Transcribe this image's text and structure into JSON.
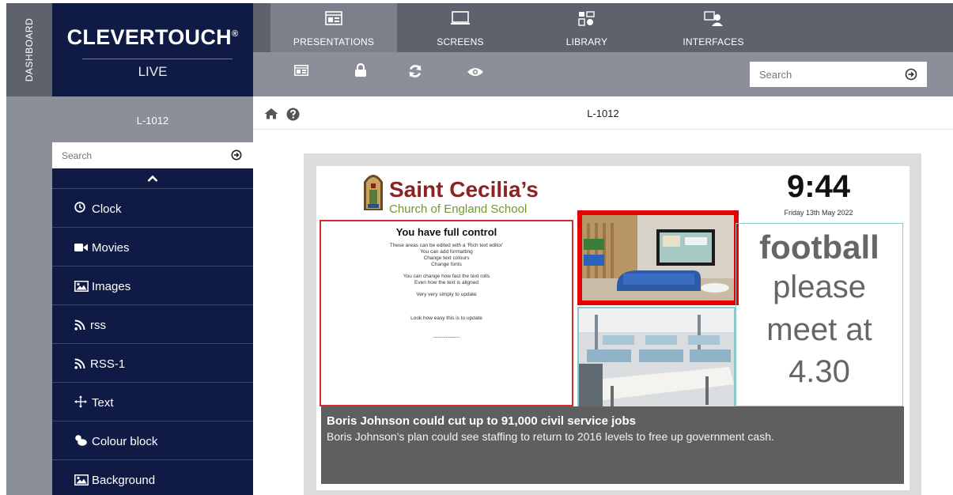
{
  "sidebar_strip": {
    "label": "DASHBOARD"
  },
  "brand": {
    "logo": "CLEVERTOUCH",
    "logo_mark": "®",
    "subtitle": "LIVE"
  },
  "top_tabs": [
    {
      "label": "PRESENTATIONS",
      "icon": "presentation-icon",
      "active": true
    },
    {
      "label": "SCREENS",
      "icon": "screen-icon",
      "active": false
    },
    {
      "label": "LIBRARY",
      "icon": "library-icon",
      "active": false
    },
    {
      "label": "INTERFACES",
      "icon": "interfaces-icon",
      "active": false
    }
  ],
  "toolbar": {
    "icons": [
      "layout-icon",
      "lock-icon",
      "refresh-icon",
      "eye-icon"
    ],
    "search_placeholder": "Search"
  },
  "left_panel": {
    "title": "L-1012",
    "search_placeholder": "Search",
    "items": [
      {
        "label": "Clock",
        "icon": "clock-icon"
      },
      {
        "label": "Movies",
        "icon": "video-camera-icon"
      },
      {
        "label": "Images",
        "icon": "image-icon"
      },
      {
        "label": "rss",
        "icon": "rss-icon"
      },
      {
        "label": "RSS-1",
        "icon": "rss-icon"
      },
      {
        "label": "Text",
        "icon": "move-icon"
      },
      {
        "label": "Colour block",
        "icon": "paint-icon"
      },
      {
        "label": "Background",
        "icon": "image-icon"
      }
    ]
  },
  "main": {
    "title": "L-1012"
  },
  "slide": {
    "school_name": "Saint Cecilia’s",
    "school_sub": "Church of England School",
    "clock_time": "9:44",
    "clock_date": "Friday 13th May 2022",
    "text_heading": "You have full control",
    "text_lines_1": [
      "These areas can be edited with a 'Rich text editor'",
      "You can add formatting",
      "Change text colours",
      "Change fonts"
    ],
    "text_lines_2": [
      "You can change how fast the text rolls",
      "Even how the text is aligned"
    ],
    "text_line_3": "Very very simply to update",
    "text_line_4": "Look how easy this is to update",
    "text_line_5": "---------------",
    "notice": [
      "football",
      "please",
      "meet at",
      "4.30"
    ],
    "ticker_headline": "Boris Johnson could cut up to 91,000 civil service jobs",
    "ticker_body": "Boris Johnson's plan could see staffing to return to 2016 levels to free up government cash."
  },
  "colors": {
    "navy": "#0f1b44",
    "grey_dark": "#5e626d",
    "grey_mid": "#8b8f99",
    "highlight_red": "#e60000"
  }
}
